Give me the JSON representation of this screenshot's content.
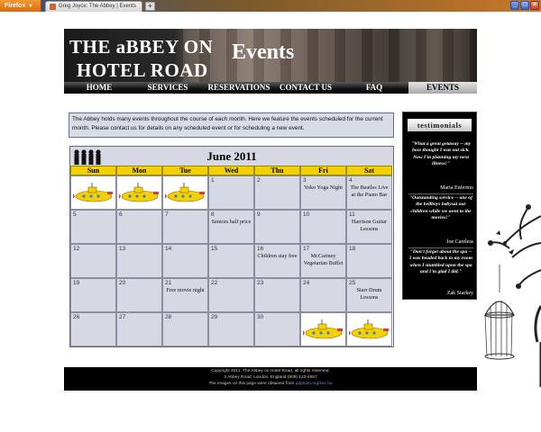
{
  "browser": {
    "app_button": "Firefox",
    "tab_title": "Greg Joyce: The Abbey | Events",
    "new_tab": "+"
  },
  "header": {
    "logo_line1": "THE aBBEY ON",
    "logo_line2": "HOTEL ROAD",
    "page_heading": "Events"
  },
  "nav": {
    "items": [
      "HOME",
      "SERVICES",
      "RESERVATIONS",
      "CONTACT US",
      "FAQ",
      "EVENTS"
    ],
    "active": "EVENTS"
  },
  "intro": "The Abbey holds many events throughout the course of each month. Here we feature the events scheduled for the current month. Please contact us for details on any scheduled event or for scheduling a new event.",
  "calendar": {
    "title": "June 2011",
    "weekdays": [
      "Sun",
      "Mon",
      "Tue",
      "Wed",
      "Thu",
      "Fri",
      "Sat"
    ],
    "weeks": [
      [
        {
          "day": "",
          "sub": true
        },
        {
          "day": "",
          "sub": true
        },
        {
          "day": "",
          "sub": true
        },
        {
          "day": "1",
          "event": ""
        },
        {
          "day": "2",
          "event": ""
        },
        {
          "day": "3",
          "event": "Yoko Yoga Night"
        },
        {
          "day": "4",
          "event": "The Beatles Live at the Piano Bar"
        }
      ],
      [
        {
          "day": "5",
          "event": ""
        },
        {
          "day": "6",
          "event": ""
        },
        {
          "day": "7",
          "event": ""
        },
        {
          "day": "8",
          "event": "Seniors half price"
        },
        {
          "day": "9",
          "event": ""
        },
        {
          "day": "10",
          "event": ""
        },
        {
          "day": "11",
          "event": "Harrison Guitar Lessons"
        }
      ],
      [
        {
          "day": "12",
          "event": ""
        },
        {
          "day": "13",
          "event": ""
        },
        {
          "day": "14",
          "event": ""
        },
        {
          "day": "15",
          "event": ""
        },
        {
          "day": "16",
          "event": "Children stay free"
        },
        {
          "day": "17",
          "event": "McCartney Vegetarian Buffet"
        },
        {
          "day": "18",
          "event": ""
        }
      ],
      [
        {
          "day": "19",
          "event": ""
        },
        {
          "day": "20",
          "event": ""
        },
        {
          "day": "21",
          "event": "Free movie night"
        },
        {
          "day": "22",
          "event": ""
        },
        {
          "day": "23",
          "event": ""
        },
        {
          "day": "24",
          "event": ""
        },
        {
          "day": "25",
          "event": "Starr Drum Lessons"
        }
      ],
      [
        {
          "day": "26",
          "event": ""
        },
        {
          "day": "27",
          "event": ""
        },
        {
          "day": "28",
          "event": ""
        },
        {
          "day": "29",
          "event": ""
        },
        {
          "day": "30",
          "event": ""
        },
        {
          "day": "",
          "sub": true
        },
        {
          "day": "",
          "sub": true
        }
      ]
    ],
    "sub_icon": "yellow-submarine-icon"
  },
  "sidebar": {
    "heading": "testimonials",
    "quotes": [
      {
        "text": "\"What a great getaway -- my boss thought I was out sick. Now I'm planning my next illness!\"",
        "author": "Maria Enfermo"
      },
      {
        "text": "\"Outstanding service -- one of the bellboys babysat our children while we went to the movies!\"",
        "author": "Joe Careless"
      },
      {
        "text": "\"Don't forget about the spa -- I was headed back to my room when I stumbled upon the spa and I'm glad I did.\"",
        "author": "Zak Starkey"
      }
    ]
  },
  "footer": {
    "line1": "Copyright 2011, The Abbey on Hotel Road, all rights reserved.",
    "line2": "3 Abbey Road, London, England (909) 123-4567",
    "line3_prefix": "The images on this page were obtained from",
    "line3_link": "pdphoto.org/sxc.hu"
  },
  "colors": {
    "calendar_header": "#f5d000",
    "cell_bg": "#d6d9e4",
    "sidebar_bg": "#000000"
  }
}
